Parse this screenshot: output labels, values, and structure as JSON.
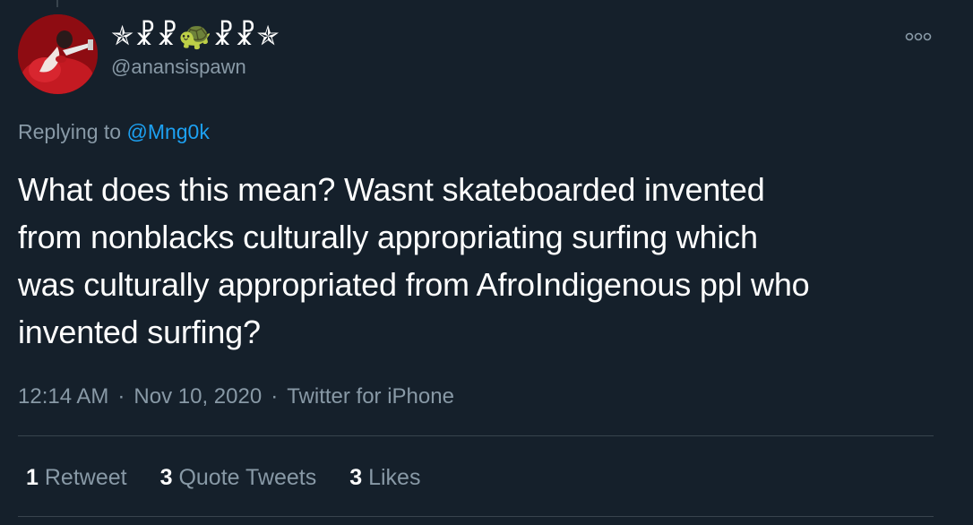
{
  "colors": {
    "background": "#15202b",
    "text_primary": "#ffffff",
    "text_secondary": "#8899a6",
    "link": "#1da1f2",
    "divider": "#38444d"
  },
  "author": {
    "display_name": "✯☧☧🐢☧☧✯",
    "handle": "@anansispawn",
    "avatar_icon": "avatar-photo"
  },
  "more_icon": "more-options-icon",
  "reply": {
    "prefix": "Replying to",
    "mention": "@Mng0k"
  },
  "tweet": {
    "lines": [
      "What does this mean? Wasnt skateboarded invented",
      "from nonblacks culturally appropriating surfing which",
      "was culturally appropriated from AfroIndigenous ppl who",
      "invented surfing?"
    ]
  },
  "meta": {
    "time": "12:14 AM",
    "separator": "·",
    "date": "Nov 10, 2020",
    "source": "Twitter for iPhone"
  },
  "stats": [
    {
      "count": "1",
      "label": "Retweet"
    },
    {
      "count": "3",
      "label": "Quote Tweets"
    },
    {
      "count": "3",
      "label": "Likes"
    }
  ]
}
